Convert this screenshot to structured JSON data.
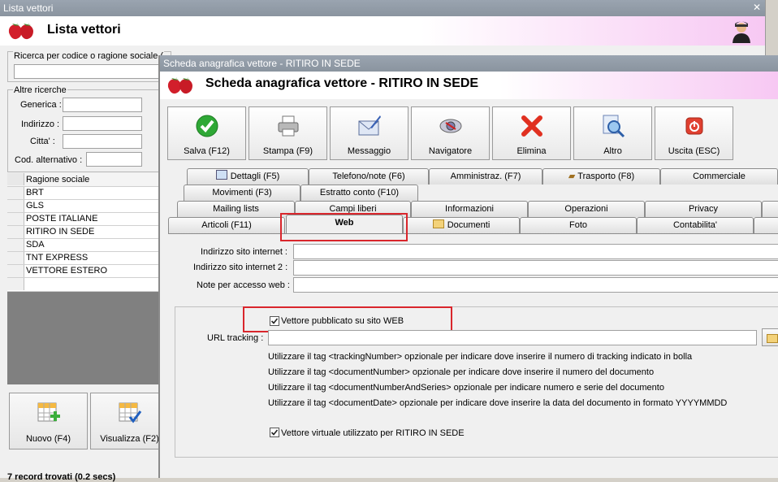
{
  "back_window": {
    "titlebar": "Lista vettori",
    "header_title": "Lista vettori",
    "search": {
      "legend": "Ricerca per codice o ragione sociale (",
      "value": ""
    },
    "other_search": {
      "legend": "Altre ricerche",
      "fields": [
        {
          "label": "Generica :",
          "value": ""
        },
        {
          "label": "Indirizzo :",
          "value": ""
        },
        {
          "label": "Citta' :",
          "value": ""
        },
        {
          "label": "Cod. alternativo :",
          "value": ""
        }
      ]
    },
    "grid": {
      "header": "Ragione sociale",
      "rows": [
        "BRT",
        "GLS",
        "POSTE ITALIANE",
        "RITIRO IN SEDE",
        "SDA",
        "TNT EXPRESS",
        "VETTORE ESTERO"
      ]
    },
    "buttons": {
      "new": "Nuovo (F4)",
      "view": "Visualizza (F2)"
    },
    "status": "7 record trovati (0.2 secs)"
  },
  "front_window": {
    "titlebar": "Scheda anagrafica vettore - RITIRO IN SEDE",
    "header_title": "Scheda anagrafica vettore - RITIRO IN SEDE",
    "toolbar": [
      {
        "label": "Salva (F12)",
        "icon": "check-icon"
      },
      {
        "label": "Stampa (F9)",
        "icon": "printer-icon"
      },
      {
        "label": "Messaggio",
        "icon": "message-icon"
      },
      {
        "label": "Navigatore",
        "icon": "navigator-icon"
      },
      {
        "label": "Elimina",
        "icon": "delete-icon"
      },
      {
        "label": "Altro",
        "icon": "search-icon"
      },
      {
        "label": "Uscita (ESC)",
        "icon": "exit-icon"
      }
    ],
    "tabs": {
      "row1": [
        "Dettagli (F5)",
        "Telefono/note (F6)",
        "Amministraz. (F7)",
        "Trasporto (F8)",
        "Commerciale"
      ],
      "row2": [
        "Movimenti (F3)",
        "Estratto conto (F10)"
      ],
      "row3": [
        "Mailing lists",
        "Campi liberi",
        "Informazioni",
        "Operazioni",
        "Privacy"
      ],
      "row4": [
        "Articoli (F11)",
        "Web",
        "Documenti",
        "Foto",
        "Contabilita'"
      ],
      "active": "Web"
    },
    "web": {
      "site_label": "Indirizzo sito internet :",
      "site_value": "",
      "site2_label": "Indirizzo sito internet 2 :",
      "site2_value": "",
      "notes_label": "Note per accesso web :",
      "notes_value": "",
      "published_label": "Vettore pubblicato su sito WEB",
      "published_checked": true,
      "url_label": "URL tracking :",
      "url_value": "",
      "hints": [
        "Utilizzare il tag <trackingNumber> opzionale per indicare dove inserire il numero di tracking indicato in bolla",
        "Utilizzare il tag <documentNumber> opzionale per indicare dove inserire il numero del documento",
        "Utilizzare il tag <documentNumberAndSeries> opzionale per indicare numero e serie del documento",
        "Utilizzare il tag <documentDate> opzionale per indicare dove inserire la data del documento in formato YYYYMMDD"
      ],
      "virtual_label": "Vettore virtuale utilizzato per RITIRO IN SEDE",
      "virtual_checked": true
    },
    "colors": {
      "highlight": "#d9262c",
      "header_gradient_end": "#f7c8f3"
    }
  }
}
